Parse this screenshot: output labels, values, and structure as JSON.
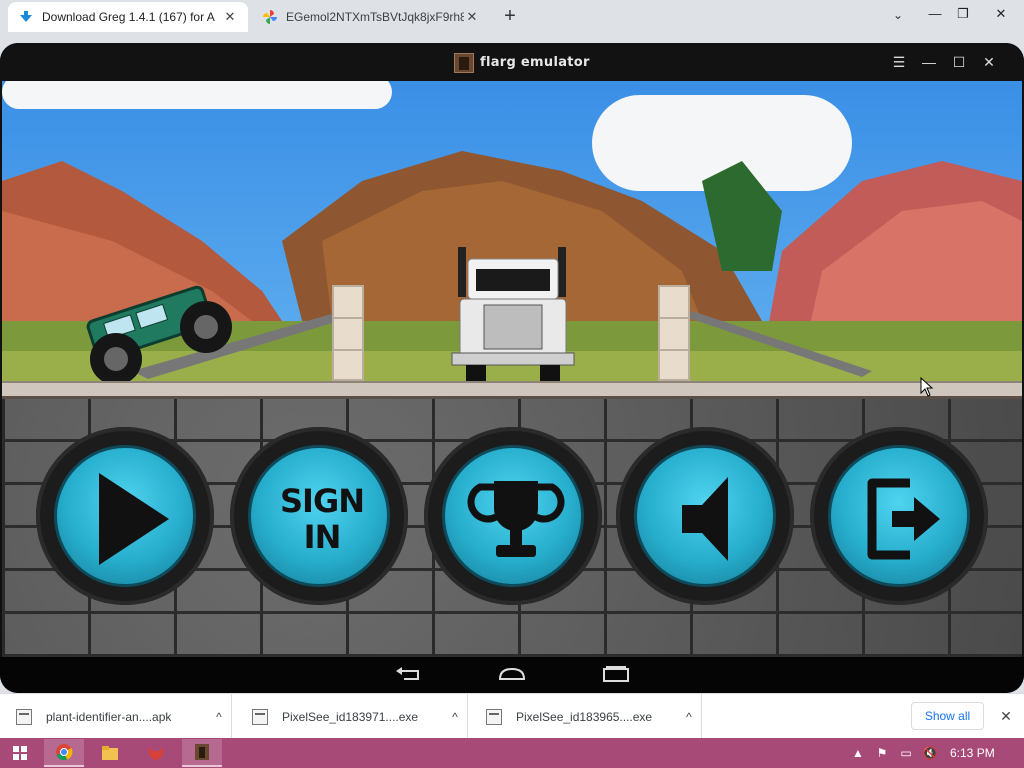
{
  "browser": {
    "tabs": [
      {
        "title": "Download Greg 1.4.1 (167) for A",
        "icon": "download-arrow-icon",
        "active": true
      },
      {
        "title": "EGemol2NTXmTsBVtJqk8jxF9rh8",
        "icon": "photos-pinwheel-icon",
        "active": false
      }
    ],
    "close_glyph": "✕",
    "new_tab_glyph": "+",
    "tab_search_glyph": "⌄",
    "window_controls": {
      "minimize": "—",
      "restore": "❐",
      "close": "✕"
    }
  },
  "emulator": {
    "title": "flarg emulator",
    "controls": {
      "menu": "☰",
      "minimize": "—",
      "maximize": "☐",
      "close": "✕"
    },
    "menu_buttons": [
      {
        "name": "play",
        "icon": "play-icon"
      },
      {
        "name": "sign-in",
        "line1": "SIGN",
        "line2": "IN"
      },
      {
        "name": "leaderboard",
        "icon": "trophy-icon"
      },
      {
        "name": "sound",
        "icon": "speaker-icon"
      },
      {
        "name": "exit",
        "icon": "exit-door-icon"
      }
    ],
    "nav": {
      "back": "back-icon",
      "home": "home-icon",
      "recents": "recents-icon"
    },
    "colors": {
      "button_face": "#27aecd",
      "button_ring": "#1c1c1c",
      "sky": "#3a8fe6"
    }
  },
  "downloads": {
    "items": [
      {
        "filename": "plant-identifier-an....apk",
        "chevron": "^"
      },
      {
        "filename": "PixelSee_id183971....exe",
        "chevron": "^"
      },
      {
        "filename": "PixelSee_id183965....exe",
        "chevron": "^"
      }
    ],
    "show_all": "Show all",
    "close_glyph": "✕"
  },
  "taskbar": {
    "start_icon": "windows-start-icon",
    "pinned": [
      "chrome-icon",
      "file-explorer-icon",
      "fox-app-icon",
      "emulator-app-icon"
    ],
    "tray": {
      "up": "▲",
      "flag": "⚑",
      "network": "▭",
      "volume": "🔇"
    },
    "time": "6:13 PM",
    "color": "#a84a78"
  }
}
